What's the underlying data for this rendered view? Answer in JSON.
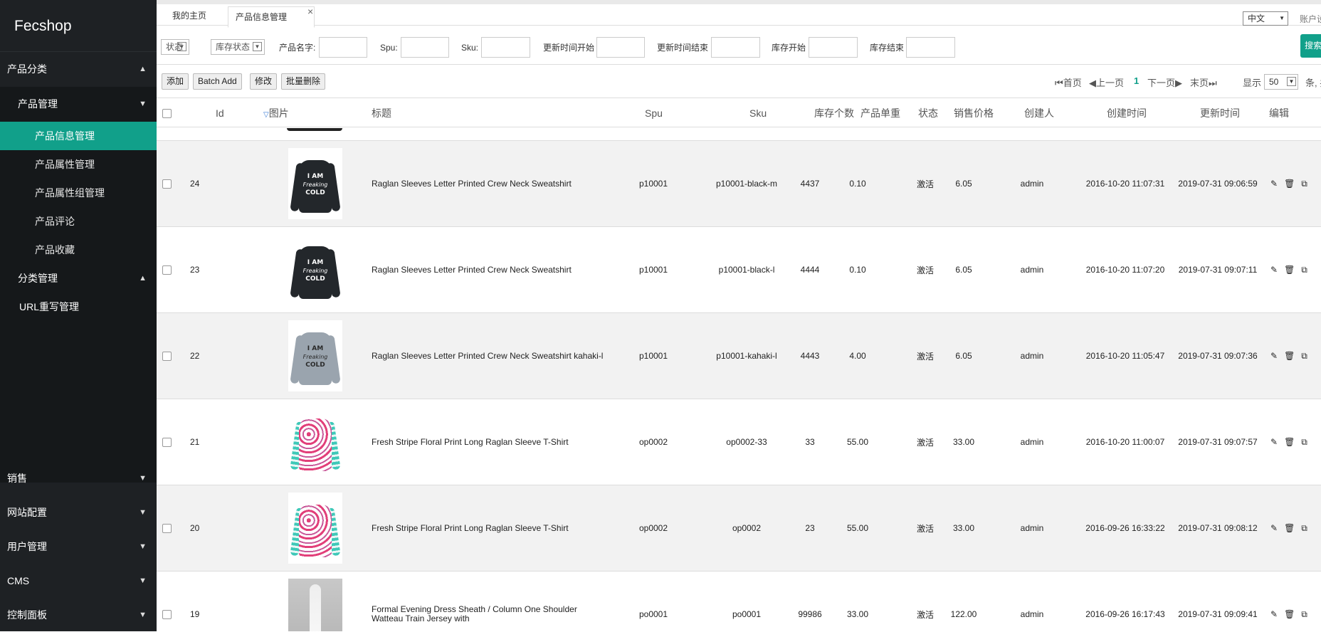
{
  "brand": "Fecshop",
  "sidebar": {
    "product_category": "产品分类",
    "product_management": "产品管理",
    "leaves": [
      "产品信息管理",
      "产品属性管理",
      "产品属性组管理",
      "产品评论",
      "产品收藏"
    ],
    "category_management": "分类管理",
    "url_rewrite": "URL重写管理",
    "bottom": [
      "销售",
      "网站配置",
      "用户管理",
      "CMS",
      "控制面板"
    ]
  },
  "tabs": {
    "home": "我的主页",
    "product": "产品信息管理",
    "close": "×"
  },
  "header": {
    "language": "中文",
    "account": "账户设置"
  },
  "search": {
    "status_select": "状态",
    "stock_status_select": "库存状态",
    "product_name_label": "产品名字:",
    "spu_label": "Spu:",
    "sku_label": "Sku:",
    "updated_start_label": "更新时间开始",
    "updated_end_label": "更新时间结束",
    "stock_start_label": "库存开始",
    "stock_end_label": "库存结束",
    "search_button": "搜索"
  },
  "toolbar": {
    "add": "添加",
    "batch_add": "Batch Add",
    "edit": "修改",
    "batch_delete": "批量删除"
  },
  "pager": {
    "first": "首页",
    "prev": "上一页",
    "current": "1",
    "next": "下一页",
    "last": "末页",
    "show_label": "显示",
    "page_size": "50",
    "suffix": "条, 共"
  },
  "table": {
    "headers": {
      "id": "Id",
      "image": "图片",
      "title": "标题",
      "spu": "Spu",
      "sku": "Sku",
      "stock": "库存个数",
      "unit_price": "产品单重",
      "status": "状态",
      "price": "销售价格",
      "creator": "创建人",
      "created_at": "创建时间",
      "updated_at": "更新时间",
      "edit": "编辑"
    },
    "rows": [
      {
        "id": "24",
        "image": "sweatshirt-black",
        "title": "Raglan Sleeves Letter Printed Crew Neck Sweatshirt",
        "spu": "p10001",
        "sku": "p10001-black-m",
        "stock": "4437",
        "weight": "0.10",
        "status": "激活",
        "price": "6.05",
        "creator": "admin",
        "created": "2016-10-20 11:07:31",
        "updated": "2019-07-31 09:06:59"
      },
      {
        "id": "23",
        "image": "sweatshirt-black",
        "title": "Raglan Sleeves Letter Printed Crew Neck Sweatshirt",
        "spu": "p10001",
        "sku": "p10001-black-l",
        "stock": "4444",
        "weight": "0.10",
        "status": "激活",
        "price": "6.05",
        "creator": "admin",
        "created": "2016-10-20 11:07:20",
        "updated": "2019-07-31 09:07:11"
      },
      {
        "id": "22",
        "image": "sweatshirt-grey",
        "title": "Raglan Sleeves Letter Printed Crew Neck Sweatshirt kahaki-l",
        "spu": "p10001",
        "sku": "p10001-kahaki-l",
        "stock": "4443",
        "weight": "4.00",
        "status": "激活",
        "price": "6.05",
        "creator": "admin",
        "created": "2016-10-20 11:05:47",
        "updated": "2019-07-31 09:07:36"
      },
      {
        "id": "21",
        "image": "floral-tshirt",
        "title": "Fresh Stripe Floral Print Long Raglan Sleeve T-Shirt",
        "spu": "op0002",
        "sku": "op0002-33",
        "stock": "33",
        "weight": "55.00",
        "status": "激活",
        "price": "33.00",
        "creator": "admin",
        "created": "2016-10-20 11:00:07",
        "updated": "2019-07-31 09:07:57"
      },
      {
        "id": "20",
        "image": "floral-tshirt",
        "title": "Fresh Stripe Floral Print Long Raglan Sleeve T-Shirt",
        "spu": "op0002",
        "sku": "op0002",
        "stock": "23",
        "weight": "55.00",
        "status": "激活",
        "price": "33.00",
        "creator": "admin",
        "created": "2016-09-26 16:33:22",
        "updated": "2019-07-31 09:08:12"
      },
      {
        "id": "19",
        "image": "evening-dress",
        "title": "Formal Evening Dress Sheath / Column One Shoulder Watteau Train Jersey with",
        "spu": "po0001",
        "sku": "po0001",
        "stock": "99986",
        "weight": "33.00",
        "status": "激活",
        "price": "122.00",
        "creator": "admin",
        "created": "2016-09-26 16:17:43",
        "updated": "2019-07-31 09:09:41"
      }
    ],
    "sweatshirt_text": "I AM Freaking COLD"
  },
  "colors": {
    "sidebar_bg": "#1e2124",
    "accent": "#11a08a",
    "sweatshirt_black": "#23272b",
    "sweatshirt_grey": "#9aa4ae"
  }
}
